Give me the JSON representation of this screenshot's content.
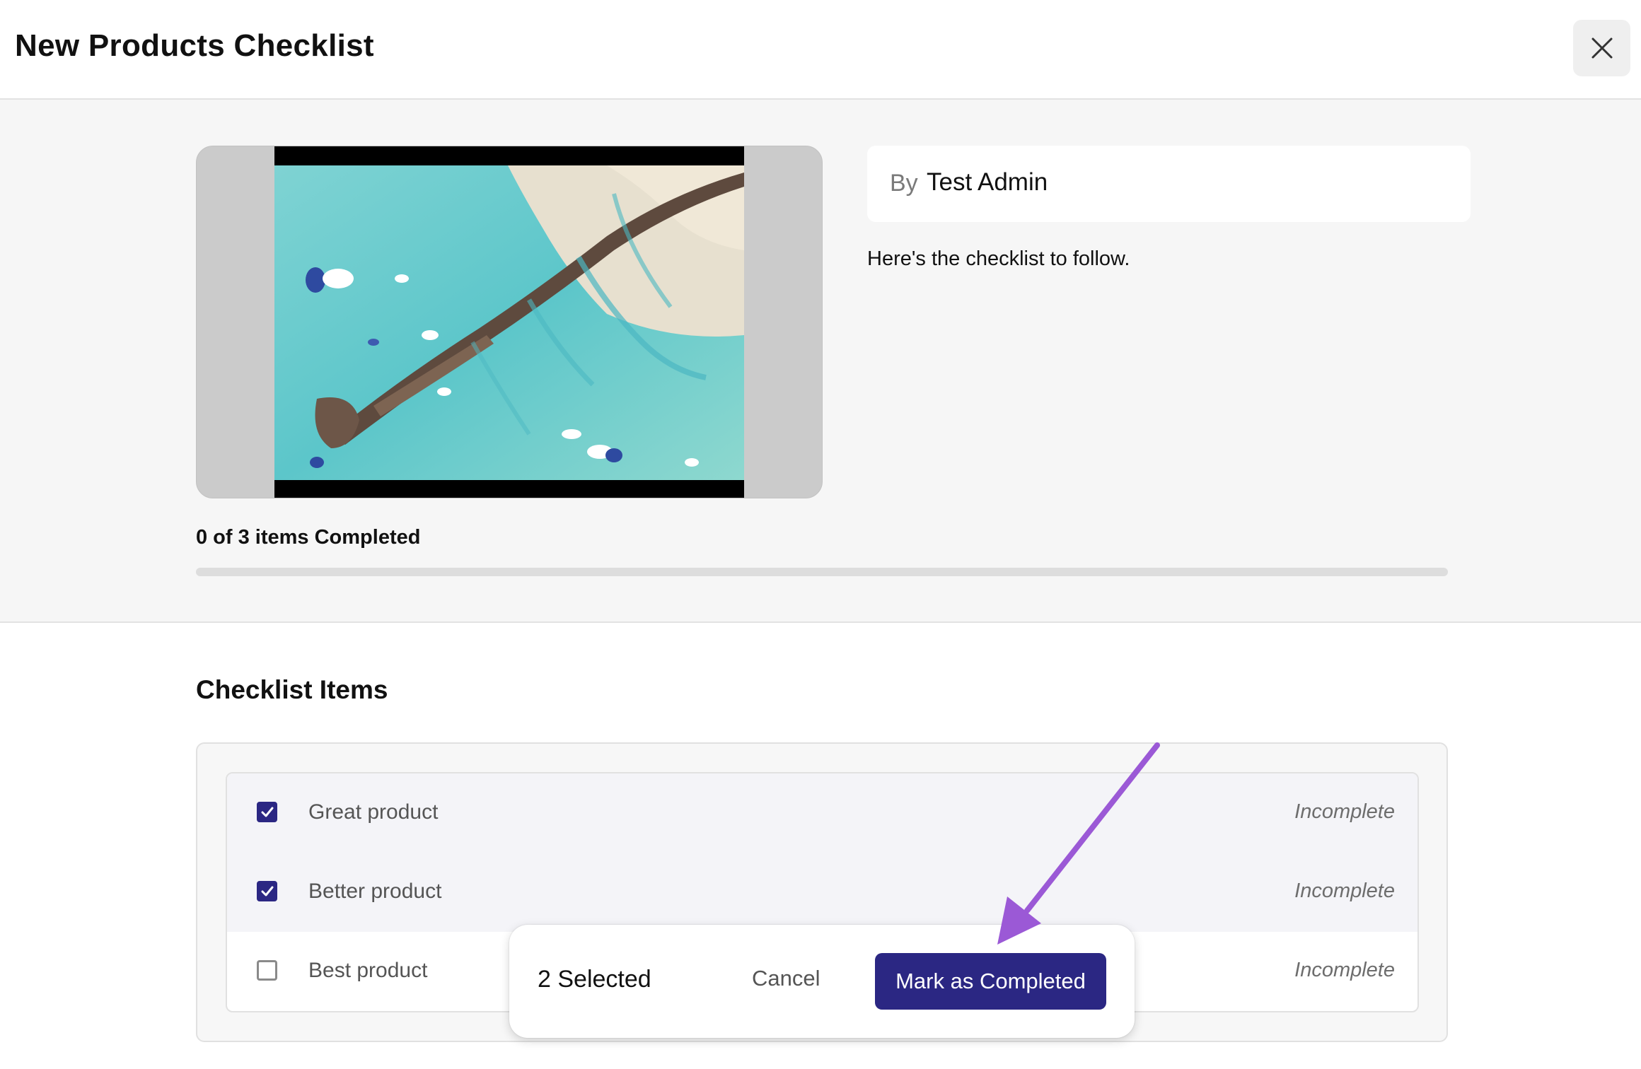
{
  "header": {
    "title": "New Products Checklist",
    "close_icon": "close-icon"
  },
  "hero": {
    "author_prefix": "By",
    "author_name": "Test Admin",
    "description": "Here's the checklist to follow.",
    "progress_text": "0 of 3 items Completed",
    "progress": {
      "completed": 0,
      "total": 3
    }
  },
  "checklist": {
    "title": "Checklist Items",
    "items": [
      {
        "label": "Great product",
        "status": "Incomplete",
        "checked": true
      },
      {
        "label": "Better product",
        "status": "Incomplete",
        "checked": true
      },
      {
        "label": "Best product",
        "status": "Incomplete",
        "checked": false
      }
    ]
  },
  "action_bar": {
    "selected_text": "2 Selected",
    "cancel_label": "Cancel",
    "complete_label": "Mark as Completed"
  },
  "colors": {
    "accent": "#2b2783",
    "annotation": "#9b59d6"
  }
}
